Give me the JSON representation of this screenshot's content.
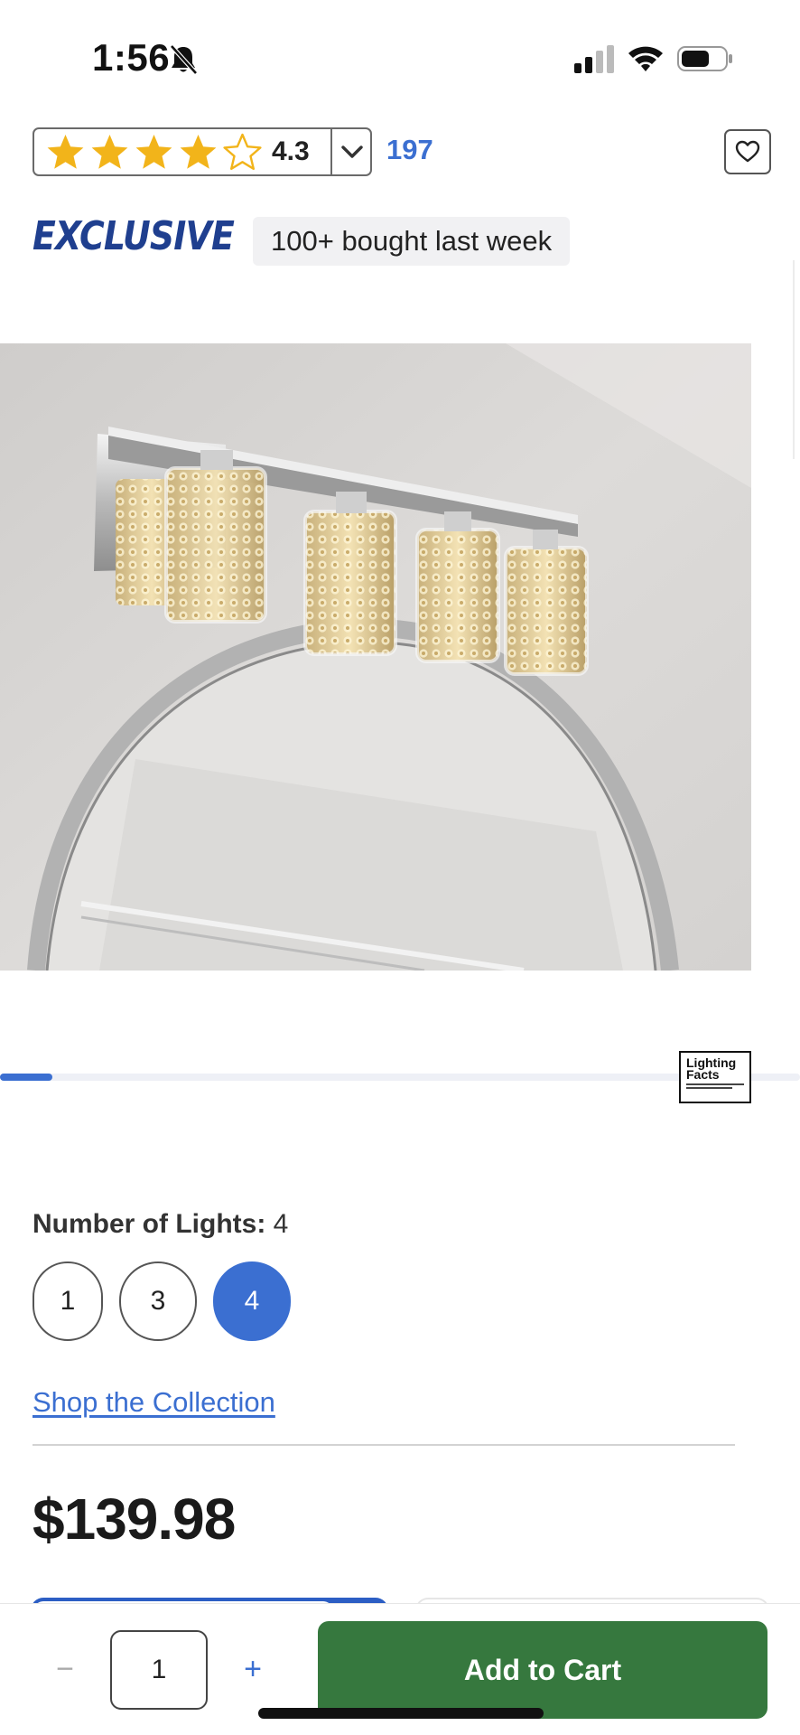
{
  "status_bar": {
    "time": "1:56",
    "icons": [
      "bell-slash-icon",
      "cellular-signal-icon",
      "wifi-icon",
      "battery-icon"
    ]
  },
  "rating": {
    "value": "4.3",
    "stars_filled": 4,
    "stars_total": 5,
    "review_count": "197",
    "star_color": "#f2b41a"
  },
  "badges": {
    "exclusive": "EXCLUSIVE",
    "bought": "100+ bought last week"
  },
  "carousel": {
    "current_index": 1,
    "lighting_facts_title_line1": "Lighting",
    "lighting_facts_title_line2": "Facts"
  },
  "options": {
    "label": "Number of Lights:",
    "selected_value": "4",
    "choices": [
      "1",
      "3",
      "4"
    ]
  },
  "links": {
    "shop_collection": "Shop the Collection"
  },
  "price": "$139.98",
  "cart_bar": {
    "minus_label": "−",
    "quantity": "1",
    "plus_label": "+",
    "add_to_cart_label": "Add to Cart"
  },
  "colors": {
    "accent_blue": "#3b6fd1",
    "exclusive_navy": "#1f3f8f",
    "cart_green": "#36783e"
  }
}
